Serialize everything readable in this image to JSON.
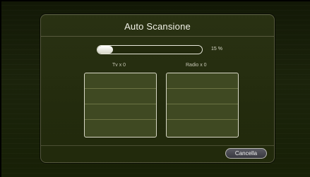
{
  "dialog": {
    "title": "Auto Scansione"
  },
  "progress": {
    "percent": 15,
    "label": "15 %"
  },
  "counts": {
    "tv_label": "Tv x  0",
    "radio_label": "Radio x  0"
  },
  "lists": {
    "tv_rows": 4,
    "radio_rows": 4
  },
  "buttons": {
    "cancel_label": "Cancella"
  },
  "colors": {
    "background": "#1b230b",
    "dialog": "#2c3414",
    "list": "#3f4922",
    "progress_fill": "#d6d6c8"
  }
}
